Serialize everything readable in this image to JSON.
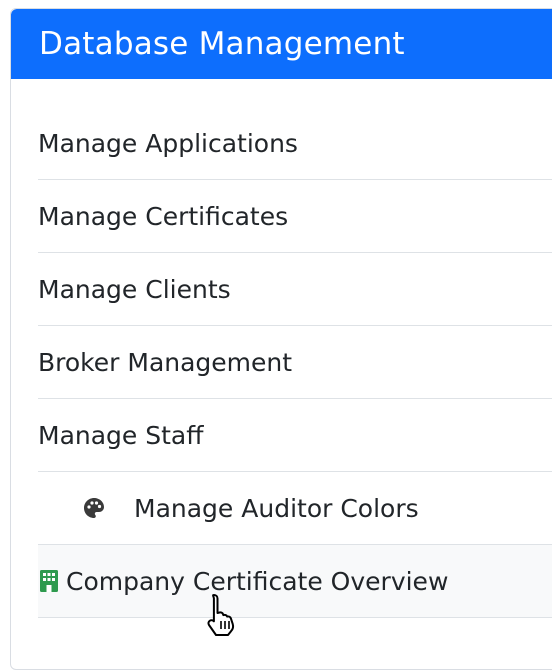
{
  "panel": {
    "title": "Database Management"
  },
  "menu": {
    "items": [
      {
        "label": "Manage Applications"
      },
      {
        "label": "Manage Certificates"
      },
      {
        "label": "Manage Clients"
      },
      {
        "label": "Broker Management"
      },
      {
        "label": "Manage Staff"
      },
      {
        "label": "Manage Auditor Colors",
        "icon": "palette-icon"
      },
      {
        "label": "Company Certificate Overview",
        "icon": "building-icon"
      }
    ]
  },
  "colors": {
    "header_bg": "#0d6efd",
    "building_icon": "#2e9a4e",
    "palette_icon": "#3a3a3a"
  },
  "cursor": {
    "icon": "hand-pointer-icon"
  }
}
